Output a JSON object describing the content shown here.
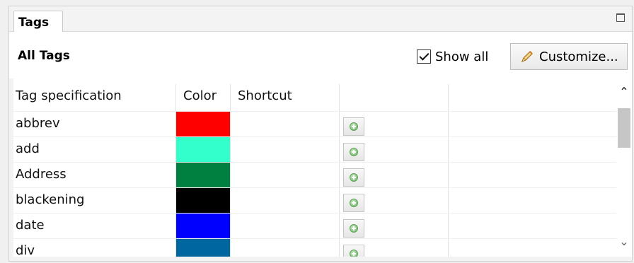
{
  "tab": {
    "label": "Tags"
  },
  "toolbar": {
    "title": "All Tags",
    "show_all_label": "Show all",
    "show_all_checked": true,
    "customize_label": "Customize..."
  },
  "table": {
    "columns": [
      "Tag specification",
      "Color",
      "Shortcut",
      ""
    ],
    "rows": [
      {
        "name": "abbrev",
        "color": "#ff0000",
        "shortcut": ""
      },
      {
        "name": "add",
        "color": "#33ffcc",
        "shortcut": ""
      },
      {
        "name": "Address",
        "color": "#008040",
        "shortcut": ""
      },
      {
        "name": "blackening",
        "color": "#000000",
        "shortcut": ""
      },
      {
        "name": "date",
        "color": "#0000ff",
        "shortcut": ""
      },
      {
        "name": "div",
        "color": "#0066a0",
        "shortcut": ""
      }
    ]
  },
  "icons": {
    "maximize": "maximize-icon",
    "checkbox": "checkbox-checked-icon",
    "customize": "pencil-icon",
    "add": "add-icon",
    "scroll_up": "chevron-up-icon",
    "scroll_down": "chevron-down-icon"
  }
}
